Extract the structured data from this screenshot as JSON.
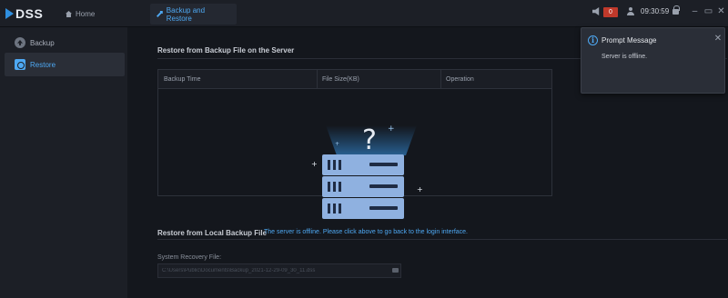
{
  "app": {
    "name": "DSS"
  },
  "tabs": [
    {
      "label": "Home",
      "icon": "home-icon"
    },
    {
      "label": "Backup and Restore",
      "icon": "wrench-icon",
      "active": true
    }
  ],
  "header": {
    "alarm_count": "0",
    "time": "09:30:59",
    "accent_color": "#4ea8f2",
    "alarm_color": "#c0392b"
  },
  "sidebar": {
    "items": [
      {
        "label": "Backup",
        "icon": "upload-icon"
      },
      {
        "label": "Restore",
        "icon": "restore-icon",
        "active": true
      }
    ]
  },
  "main": {
    "server_section_title": "Restore from Backup File on the Server",
    "table": {
      "columns": [
        "Backup Time",
        "File Size(KB)",
        "Operation"
      ],
      "rows": []
    },
    "local_section_title": "Restore from Local Backup File",
    "offline_note": "The server is offline. Please click above to go back to the login interface.",
    "recovery_label": "System Recovery File:",
    "recovery_value": "C:\\Users\\Public\\Documents\\Backup_2021-12-29-09_30_11.dss"
  },
  "prompt": {
    "title": "Prompt Message",
    "message": "Server is offline."
  }
}
